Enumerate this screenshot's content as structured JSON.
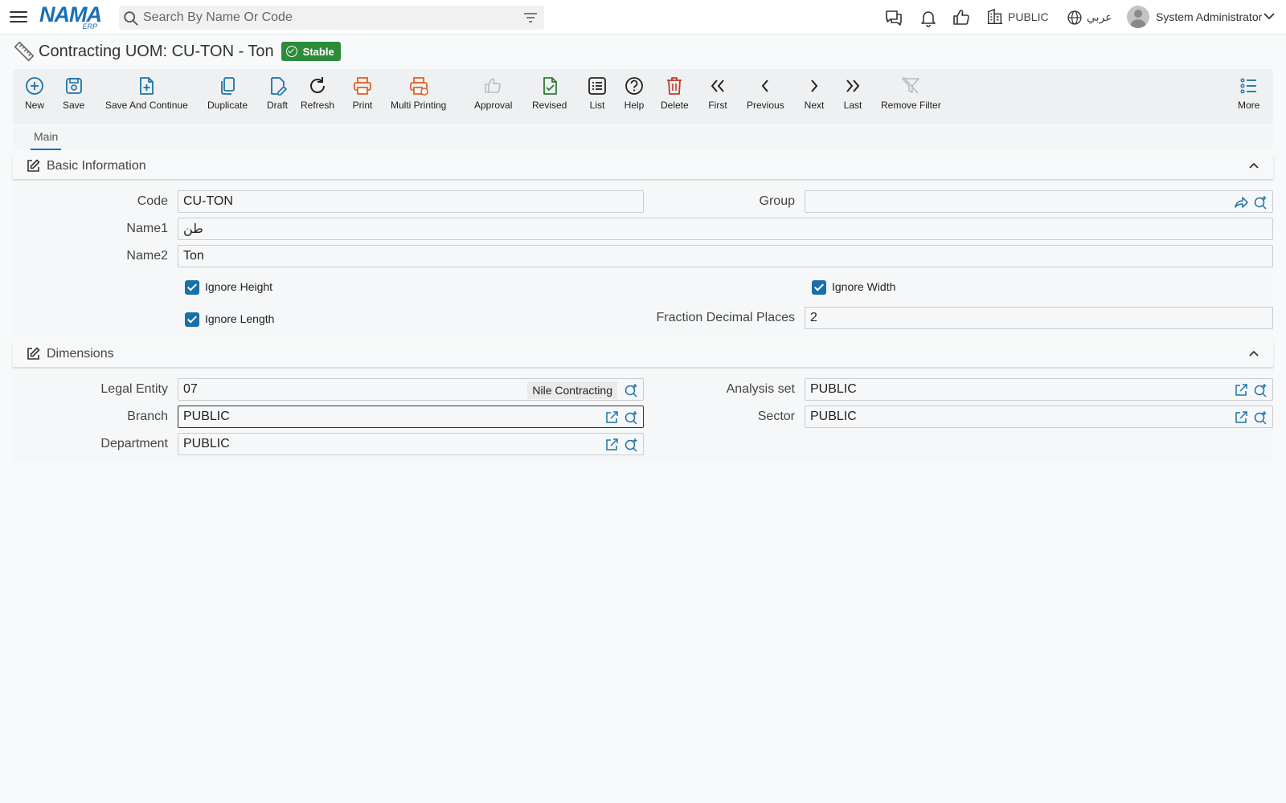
{
  "app": {
    "logo_main": "NAMA",
    "logo_sub": "ERP",
    "search_placeholder": "Search By Name Or Code",
    "entity": "PUBLIC",
    "language": "عربي",
    "user": "System Administrator"
  },
  "page": {
    "title": "Contracting UOM: CU-TON - Ton",
    "status": "Stable"
  },
  "toolbar": {
    "new": "New",
    "save": "Save",
    "save_continue": "Save And Continue",
    "duplicate": "Duplicate",
    "draft": "Draft",
    "refresh": "Refresh",
    "print": "Print",
    "multi_printing": "Multi Printing",
    "approval": "Approval",
    "revised": "Revised",
    "list": "List",
    "help": "Help",
    "delete": "Delete",
    "first": "First",
    "previous": "Previous",
    "next": "Next",
    "last": "Last",
    "remove_filter": "Remove Filter",
    "more": "More"
  },
  "tabs": {
    "main": "Main"
  },
  "basic": {
    "title": "Basic Information",
    "code_label": "Code",
    "code": "CU-TON",
    "group_label": "Group",
    "group": "",
    "name1_label": "Name1",
    "name1": "طن",
    "name2_label": "Name2",
    "name2": "Ton",
    "ignore_height": "Ignore Height",
    "ignore_width": "Ignore Width",
    "ignore_length": "Ignore Length",
    "fraction_label": "Fraction Decimal Places",
    "fraction": "2"
  },
  "dimensions": {
    "title": "Dimensions",
    "legal_entity_label": "Legal Entity",
    "legal_entity": "07",
    "legal_entity_name": "Nile Contracting",
    "analysis_set_label": "Analysis set",
    "analysis_set": "PUBLIC",
    "branch_label": "Branch",
    "branch": "PUBLIC",
    "sector_label": "Sector",
    "sector": "PUBLIC",
    "department_label": "Department",
    "department": "PUBLIC"
  },
  "colors": {
    "accent_blue": "#1b73a8",
    "print_orange": "#e0622a",
    "revised_green": "#2e7d32",
    "delete_red": "#c0392b",
    "status_green": "#2e8b3a"
  }
}
